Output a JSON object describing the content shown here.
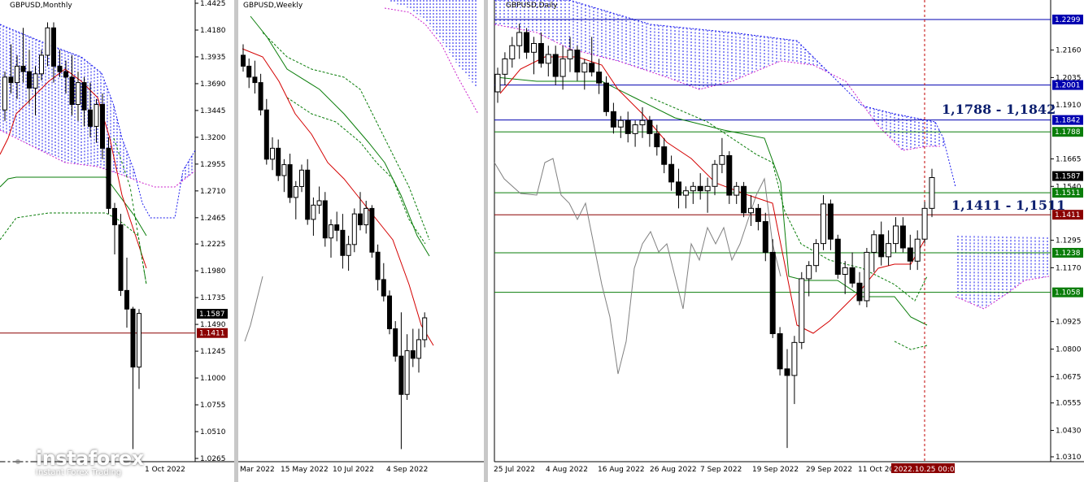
{
  "colors": {
    "candle_bull": "#ffffff",
    "candle_bear": "#000000",
    "tenkan": "#d40000",
    "kijun": "#0a7d0a",
    "chikou": "#808080",
    "kumo_a": "#1a1aee",
    "kumo_b": "#cc22cc",
    "level_blue": "#0000b0",
    "level_green": "#0a7d0a",
    "level_red": "#8b0000",
    "level_black": "#000000"
  },
  "logo": {
    "brand": "instaforex",
    "tagline": "Instant Forex Trading"
  },
  "chart_data": [
    {
      "type": "candlestick",
      "title": "GBPUSD,Monthly",
      "indicator": "Ichimoku Kinko Hyo",
      "ylim": [
        1.0265,
        1.4425
      ],
      "y_ticks": [
        "1.4425",
        "1.4180",
        "1.3935",
        "1.3690",
        "1.3445",
        "1.3200",
        "1.2955",
        "1.2710",
        "1.2465",
        "1.2225",
        "1.1980",
        "1.1735",
        "1.1490",
        "1.1245",
        "1.1000",
        "1.0755",
        "1.0510",
        "1.0265"
      ],
      "x_labels": [
        "1 Oct 2022"
      ],
      "price_tags": [
        {
          "text": "1.1587",
          "value": 1.1587,
          "style": "black"
        },
        {
          "text": "1.1411",
          "value": 1.1411,
          "style": "red"
        }
      ],
      "hlines": [
        {
          "value": 1.1411,
          "style": "red"
        }
      ],
      "candles": [
        [
          1.345,
          1.38,
          1.335,
          1.375
        ],
        [
          1.375,
          1.405,
          1.36,
          1.37
        ],
        [
          1.37,
          1.395,
          1.355,
          1.385
        ],
        [
          1.385,
          1.42,
          1.37,
          1.38
        ],
        [
          1.38,
          1.4,
          1.35,
          1.365
        ],
        [
          1.365,
          1.385,
          1.34,
          1.378
        ],
        [
          1.378,
          1.4,
          1.372,
          1.395
        ],
        [
          1.395,
          1.425,
          1.385,
          1.42
        ],
        [
          1.42,
          1.425,
          1.37,
          1.385
        ],
        [
          1.385,
          1.4,
          1.375,
          1.38
        ],
        [
          1.38,
          1.39,
          1.36,
          1.375
        ],
        [
          1.375,
          1.395,
          1.34,
          1.35
        ],
        [
          1.35,
          1.38,
          1.335,
          1.37
        ],
        [
          1.37,
          1.375,
          1.33,
          1.345
        ],
        [
          1.345,
          1.37,
          1.32,
          1.33
        ],
        [
          1.33,
          1.355,
          1.315,
          1.35
        ],
        [
          1.35,
          1.36,
          1.3,
          1.31
        ],
        [
          1.31,
          1.32,
          1.25,
          1.255
        ],
        [
          1.255,
          1.26,
          1.213,
          1.24
        ],
        [
          1.24,
          1.25,
          1.175,
          1.18
        ],
        [
          1.18,
          1.21,
          1.146,
          1.163
        ],
        [
          1.163,
          1.165,
          1.035,
          1.11
        ],
        [
          1.11,
          1.163,
          1.09,
          1.159
        ]
      ]
    },
    {
      "type": "candlestick",
      "title": "GBPUSD,Weekly",
      "indicator": "Ichimoku Kinko Hyo",
      "ylim": [
        1.0265,
        1.4425
      ],
      "x_labels": [
        "Mar 2022",
        "15 May 2022",
        "10 Jul 2022",
        "4 Sep 2022"
      ],
      "candles": [
        [
          1.395,
          1.405,
          1.38,
          1.385
        ],
        [
          1.385,
          1.392,
          1.365,
          1.375
        ],
        [
          1.375,
          1.39,
          1.36,
          1.37
        ],
        [
          1.37,
          1.378,
          1.34,
          1.345
        ],
        [
          1.345,
          1.355,
          1.295,
          1.3
        ],
        [
          1.3,
          1.32,
          1.29,
          1.31
        ],
        [
          1.31,
          1.318,
          1.28,
          1.285
        ],
        [
          1.285,
          1.3,
          1.27,
          1.295
        ],
        [
          1.295,
          1.305,
          1.26,
          1.265
        ],
        [
          1.265,
          1.28,
          1.245,
          1.275
        ],
        [
          1.275,
          1.295,
          1.27,
          1.29
        ],
        [
          1.29,
          1.3,
          1.24,
          1.245
        ],
        [
          1.245,
          1.265,
          1.23,
          1.258
        ],
        [
          1.258,
          1.275,
          1.25,
          1.262
        ],
        [
          1.262,
          1.27,
          1.22,
          1.228
        ],
        [
          1.228,
          1.245,
          1.21,
          1.24
        ],
        [
          1.24,
          1.252,
          1.225,
          1.235
        ],
        [
          1.235,
          1.25,
          1.2,
          1.212
        ],
        [
          1.212,
          1.23,
          1.198,
          1.222
        ],
        [
          1.222,
          1.255,
          1.215,
          1.25
        ],
        [
          1.25,
          1.27,
          1.235,
          1.24
        ],
        [
          1.24,
          1.262,
          1.232,
          1.255
        ],
        [
          1.255,
          1.258,
          1.21,
          1.215
        ],
        [
          1.215,
          1.222,
          1.18,
          1.19
        ],
        [
          1.19,
          1.205,
          1.17,
          1.175
        ],
        [
          1.175,
          1.18,
          1.14,
          1.145
        ],
        [
          1.145,
          1.152,
          1.115,
          1.12
        ],
        [
          1.12,
          1.16,
          1.035,
          1.085
        ],
        [
          1.085,
          1.14,
          1.08,
          1.125
        ],
        [
          1.125,
          1.145,
          1.11,
          1.118
        ],
        [
          1.118,
          1.145,
          1.105,
          1.135
        ],
        [
          1.135,
          1.16,
          1.128,
          1.155
        ]
      ]
    },
    {
      "type": "candlestick",
      "title": "GBPUSD,Daily",
      "indicator": "Ichimoku Kinko Hyo",
      "ylim": [
        1.031,
        1.2299
      ],
      "y_ticks": [
        "1.2160",
        "1.2035",
        "1.1910",
        "1.1665",
        "1.1540",
        "1.1295",
        "1.1170",
        "1.0925",
        "1.0800",
        "1.0675",
        "1.0555",
        "1.0430",
        "1.0310"
      ],
      "x_labels": [
        "25 Jul 2022",
        "4 Aug 2022",
        "16 Aug 2022",
        "26 Aug 2022",
        "7 Sep 2022",
        "19 Sep 2022",
        "29 Sep 2022",
        "11 Oct 20"
      ],
      "cursor_label": "2022.10.25 00:00",
      "price_tags": [
        {
          "text": "1.2299",
          "value": 1.2299,
          "style": "blue"
        },
        {
          "text": "1.2001",
          "value": 1.2001,
          "style": "blue"
        },
        {
          "text": "1.1842",
          "value": 1.1842,
          "style": "blue"
        },
        {
          "text": "1.1788",
          "value": 1.1788,
          "style": "green"
        },
        {
          "text": "1.1587",
          "value": 1.1587,
          "style": "black"
        },
        {
          "text": "1.1511",
          "value": 1.1511,
          "style": "green"
        },
        {
          "text": "1.1411",
          "value": 1.1411,
          "style": "red"
        },
        {
          "text": "1.1238",
          "value": 1.1238,
          "style": "green"
        },
        {
          "text": "1.1058",
          "value": 1.1058,
          "style": "green"
        }
      ],
      "hlines": [
        {
          "value": 1.2299,
          "style": "blue"
        },
        {
          "value": 1.2001,
          "style": "blue"
        },
        {
          "value": 1.1842,
          "style": "blue"
        },
        {
          "value": 1.1788,
          "style": "green"
        },
        {
          "value": 1.1511,
          "style": "green"
        },
        {
          "value": 1.1411,
          "style": "red"
        },
        {
          "value": 1.1238,
          "style": "green"
        },
        {
          "value": 1.1058,
          "style": "green"
        }
      ],
      "annotations": [
        "1,1788 - 1,1842",
        "1,1411 - 1,1511"
      ],
      "candles": [
        [
          1.197,
          1.208,
          1.192,
          1.205
        ],
        [
          1.205,
          1.215,
          1.2,
          1.212
        ],
        [
          1.212,
          1.222,
          1.208,
          1.218
        ],
        [
          1.218,
          1.228,
          1.212,
          1.224
        ],
        [
          1.224,
          1.226,
          1.212,
          1.215
        ],
        [
          1.215,
          1.222,
          1.205,
          1.219
        ],
        [
          1.219,
          1.224,
          1.208,
          1.21
        ],
        [
          1.21,
          1.218,
          1.204,
          1.214
        ],
        [
          1.214,
          1.218,
          1.2,
          1.204
        ],
        [
          1.204,
          1.218,
          1.198,
          1.212
        ],
        [
          1.212,
          1.222,
          1.206,
          1.216
        ],
        [
          1.216,
          1.218,
          1.202,
          1.206
        ],
        [
          1.206,
          1.212,
          1.198,
          1.21
        ],
        [
          1.21,
          1.222,
          1.204,
          1.206
        ],
        [
          1.206,
          1.212,
          1.196,
          1.201
        ],
        [
          1.201,
          1.204,
          1.186,
          1.188
        ],
        [
          1.188,
          1.192,
          1.178,
          1.181
        ],
        [
          1.181,
          1.186,
          1.176,
          1.184
        ],
        [
          1.184,
          1.188,
          1.174,
          1.178
        ],
        [
          1.178,
          1.184,
          1.172,
          1.182
        ],
        [
          1.182,
          1.19,
          1.176,
          1.184
        ],
        [
          1.184,
          1.186,
          1.172,
          1.178
        ],
        [
          1.178,
          1.182,
          1.168,
          1.172
        ],
        [
          1.172,
          1.176,
          1.16,
          1.164
        ],
        [
          1.164,
          1.168,
          1.152,
          1.156
        ],
        [
          1.156,
          1.162,
          1.144,
          1.15
        ],
        [
          1.15,
          1.154,
          1.144,
          1.152
        ],
        [
          1.152,
          1.156,
          1.146,
          1.154
        ],
        [
          1.154,
          1.16,
          1.148,
          1.152
        ],
        [
          1.152,
          1.158,
          1.142,
          1.154
        ],
        [
          1.154,
          1.166,
          1.15,
          1.164
        ],
        [
          1.164,
          1.176,
          1.16,
          1.168
        ],
        [
          1.168,
          1.17,
          1.146,
          1.15
        ],
        [
          1.15,
          1.156,
          1.146,
          1.154
        ],
        [
          1.154,
          1.156,
          1.14,
          1.142
        ],
        [
          1.142,
          1.15,
          1.136,
          1.144
        ],
        [
          1.144,
          1.146,
          1.134,
          1.138
        ],
        [
          1.138,
          1.142,
          1.12,
          1.124
        ],
        [
          1.124,
          1.13,
          1.085,
          1.087
        ],
        [
          1.087,
          1.09,
          1.068,
          1.071
        ],
        [
          1.071,
          1.08,
          1.035,
          1.068
        ],
        [
          1.068,
          1.086,
          1.055,
          1.083
        ],
        [
          1.083,
          1.115,
          1.08,
          1.112
        ],
        [
          1.112,
          1.12,
          1.104,
          1.118
        ],
        [
          1.118,
          1.13,
          1.115,
          1.128
        ],
        [
          1.128,
          1.15,
          1.125,
          1.146
        ],
        [
          1.146,
          1.148,
          1.125,
          1.13
        ],
        [
          1.13,
          1.132,
          1.112,
          1.114
        ],
        [
          1.114,
          1.12,
          1.105,
          1.117
        ],
        [
          1.117,
          1.124,
          1.108,
          1.11
        ],
        [
          1.11,
          1.115,
          1.1,
          1.102
        ],
        [
          1.102,
          1.126,
          1.099,
          1.124
        ],
        [
          1.124,
          1.134,
          1.115,
          1.132
        ],
        [
          1.132,
          1.138,
          1.118,
          1.122
        ],
        [
          1.122,
          1.134,
          1.118,
          1.128
        ],
        [
          1.128,
          1.14,
          1.124,
          1.136
        ],
        [
          1.136,
          1.14,
          1.124,
          1.126
        ],
        [
          1.126,
          1.132,
          1.116,
          1.12
        ],
        [
          1.12,
          1.134,
          1.116,
          1.13
        ],
        [
          1.13,
          1.147,
          1.128,
          1.144
        ],
        [
          1.144,
          1.162,
          1.14,
          1.158
        ]
      ]
    }
  ]
}
